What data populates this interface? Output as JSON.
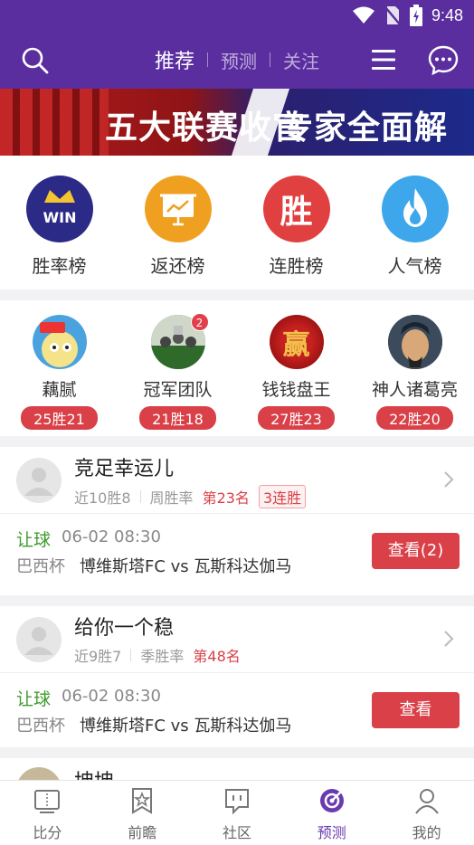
{
  "status_bar": {
    "time": "9:48"
  },
  "header": {
    "tabs": [
      {
        "label": "推荐",
        "active": true
      },
      {
        "label": "预测",
        "active": false
      },
      {
        "label": "关注",
        "active": false
      }
    ]
  },
  "banner": {
    "text_left": "五大联赛收官",
    "text_right": "专家全面解读"
  },
  "rank_categories": [
    {
      "label": "胜率榜",
      "icon": "crown-win-icon",
      "color": "#2b2a86",
      "icon_text": "WIN"
    },
    {
      "label": "返还榜",
      "icon": "chart-board-icon",
      "color": "#f0a020"
    },
    {
      "label": "连胜榜",
      "icon": "sheng-icon",
      "color": "#e04040",
      "icon_text": "胜"
    },
    {
      "label": "人气榜",
      "icon": "flame-icon",
      "color": "#3ea6ea"
    }
  ],
  "experts": [
    {
      "name": "藕腻",
      "record": "25胜21"
    },
    {
      "name": "冠军团队",
      "record": "21胜18",
      "badge": "2"
    },
    {
      "name": "钱钱盘王",
      "record": "27胜23",
      "avatar_text": "赢"
    },
    {
      "name": "神人诸葛亮",
      "record": "22胜20"
    }
  ],
  "predictions": [
    {
      "user": "竞足幸运儿",
      "recent": "近10胜8",
      "period": "周胜率",
      "rank": "第23名",
      "streak": "3连胜",
      "kind": "让球",
      "time": "06-02 08:30",
      "league": "巴西杯",
      "match": "博维斯塔FC vs 瓦斯科达伽马",
      "button": "查看(2)"
    },
    {
      "user": "给你一个稳",
      "recent": "近9胜7",
      "period": "季胜率",
      "rank": "第48名",
      "kind": "让球",
      "time": "06-02 08:30",
      "league": "巴西杯",
      "match": "博维斯塔FC vs 瓦斯科达伽马",
      "button": "查看"
    },
    {
      "user": "坤坤"
    }
  ],
  "bottom_nav": [
    {
      "label": "比分",
      "icon": "scoreboard-icon",
      "active": false
    },
    {
      "label": "前瞻",
      "icon": "star-doc-icon",
      "active": false
    },
    {
      "label": "社区",
      "icon": "chat-bubble-icon",
      "active": false
    },
    {
      "label": "预测",
      "icon": "target-icon",
      "active": true
    },
    {
      "label": "我的",
      "icon": "person-icon",
      "active": false
    }
  ],
  "colors": {
    "primary": "#5b2ea0",
    "accent_red": "#d94048",
    "green": "#3f9a2e"
  }
}
